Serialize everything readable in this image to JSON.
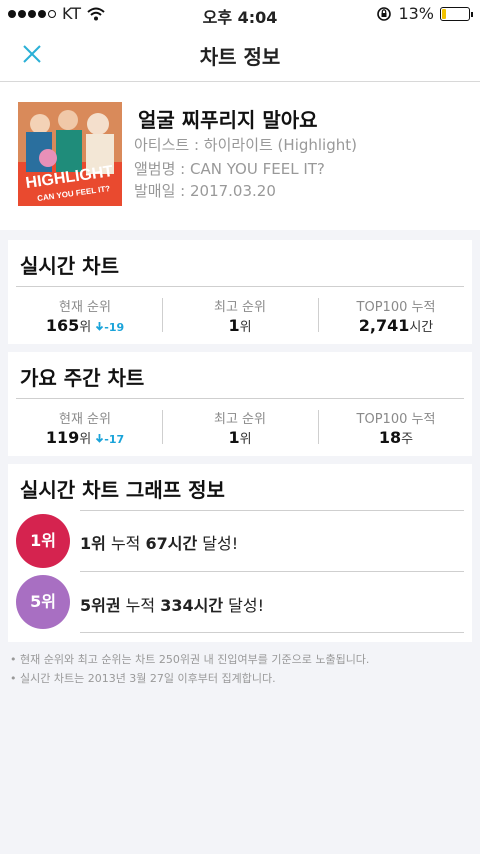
{
  "status_bar": {
    "carrier": "KT",
    "time": "오후 4:04",
    "battery": "13%",
    "battery_level": 0.13
  },
  "header": {
    "title": "차트 정보"
  },
  "song": {
    "title": "얼굴 찌푸리지 말아요",
    "artist": "아티스트 : 하이라이트 (Highlight)",
    "album": "앨범명 : CAN YOU FEEL IT?",
    "release": "발매일 : 2017.03.20",
    "cover_text": "HIGHLIGHT",
    "cover_subtext": "CAN YOU FEEL IT?"
  },
  "realtime": {
    "title": "실시간 차트",
    "current_label": "현재 순위",
    "current_value": "165",
    "current_unit": "위",
    "current_change": "-19",
    "best_label": "최고 순위",
    "best_value": "1",
    "best_unit": "위",
    "top100_label": "TOP100 누적",
    "top100_value": "2,741",
    "top100_unit": "시간"
  },
  "weekly": {
    "title": "가요 주간 차트",
    "current_label": "현재 순위",
    "current_value": "119",
    "current_unit": "위",
    "current_change": "-17",
    "best_label": "최고 순위",
    "best_value": "1",
    "best_unit": "위",
    "top100_label": "TOP100 누적",
    "top100_value": "18",
    "top100_unit": "주"
  },
  "graph": {
    "title": "실시간 차트 그래프 정보",
    "items": [
      {
        "badge": "1위",
        "strong1": "1위",
        "text1": " 누적 ",
        "strong2": "67시간",
        "text2": " 달성!",
        "color": "#d5234f"
      },
      {
        "badge": "5위",
        "strong1": "5위권",
        "text1": " 누적 ",
        "strong2": "334시간",
        "text2": " 달성!",
        "color": "#a86fc2"
      }
    ]
  },
  "notes": [
    "• 현재 순위와 최고 순위는 차트 250위권 내 진입여부를 기준으로 노출됩니다.",
    "• 실시간 차트는 2013년 3월 27일 이후부터 집계합니다."
  ]
}
